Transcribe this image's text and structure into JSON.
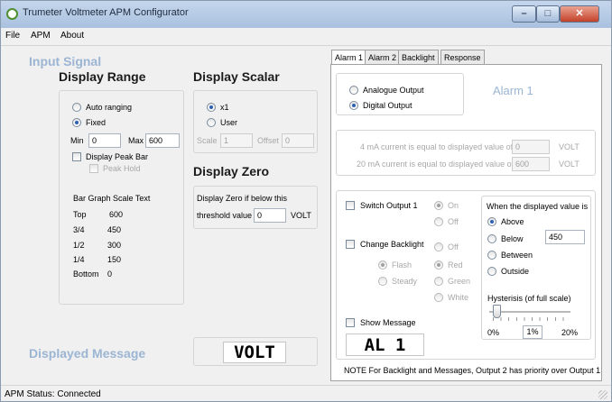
{
  "window": {
    "title": "Trumeter Voltmeter APM Configurator"
  },
  "menu": [
    "File",
    "APM",
    "About"
  ],
  "left": {
    "input_signal": "Input Signal",
    "display_range": {
      "title": "Display Range",
      "auto_ranging": "Auto ranging",
      "fixed": "Fixed",
      "mode": "Fixed",
      "min_label": "Min",
      "min_value": "0",
      "max_label": "Max",
      "max_value": "600",
      "peak_bar": "Display Peak Bar",
      "peak_hold": "Peak Hold",
      "bar_graph_title": "Bar Graph Scale Text",
      "scale_rows": [
        {
          "label": "Top",
          "value": "600"
        },
        {
          "label": "3/4",
          "value": "450"
        },
        {
          "label": "1/2",
          "value": "300"
        },
        {
          "label": "1/4",
          "value": "150"
        },
        {
          "label": "Bottom",
          "value": "0"
        }
      ]
    },
    "display_scalar": {
      "title": "Display Scalar",
      "x1": "x1",
      "user": "User",
      "selected": "x1",
      "scale_label": "Scale",
      "scale_value": "1",
      "offset_label": "Offset",
      "offset_value": "0"
    },
    "display_zero": {
      "title": "Display Zero",
      "line1": "Display Zero if below this",
      "line2": "threshold value",
      "value": "0",
      "unit": "VOLT"
    },
    "displayed_message": {
      "label": "Displayed Message",
      "value": "VOLT"
    }
  },
  "tabs": [
    {
      "label": "Alarm 1",
      "active": true
    },
    {
      "label": "Alarm 2",
      "active": false
    },
    {
      "label": "Backlight",
      "active": false
    },
    {
      "label": "Response",
      "active": false
    }
  ],
  "alarm": {
    "title": "Alarm 1",
    "analogue_output": "Analogue Output",
    "digital_output": "Digital Output",
    "output_mode": "Digital Output",
    "ma4_text": "4 mA current is equal to displayed value of",
    "ma4_value": "0",
    "ma20_text": "20 mA current is equal to displayed value of",
    "ma20_value": "600",
    "unit": "VOLT",
    "switch_output": "Switch Output 1",
    "on": "On",
    "off": "Off",
    "change_backlight": "Change Backlight",
    "bl_off": "Off",
    "flash": "Flash",
    "steady": "Steady",
    "red": "Red",
    "green": "Green",
    "white": "White",
    "show_message": "Show Message",
    "message_value": "AL 1",
    "when_title": "When the displayed value is",
    "above": "Above",
    "below": "Below",
    "between": "Between",
    "outside": "Outside",
    "condition": "Above",
    "threshold": "450",
    "hysteresis_title": "Hysterisis (of full scale)",
    "hyst_min": "0%",
    "hyst_value": "1%",
    "hyst_max": "20%",
    "hysteresis_fraction": 0.05,
    "note": "NOTE  For Backlight and Messages, Output 2 has priority over Output 1"
  },
  "status": {
    "text": "APM Status:  Connected"
  }
}
